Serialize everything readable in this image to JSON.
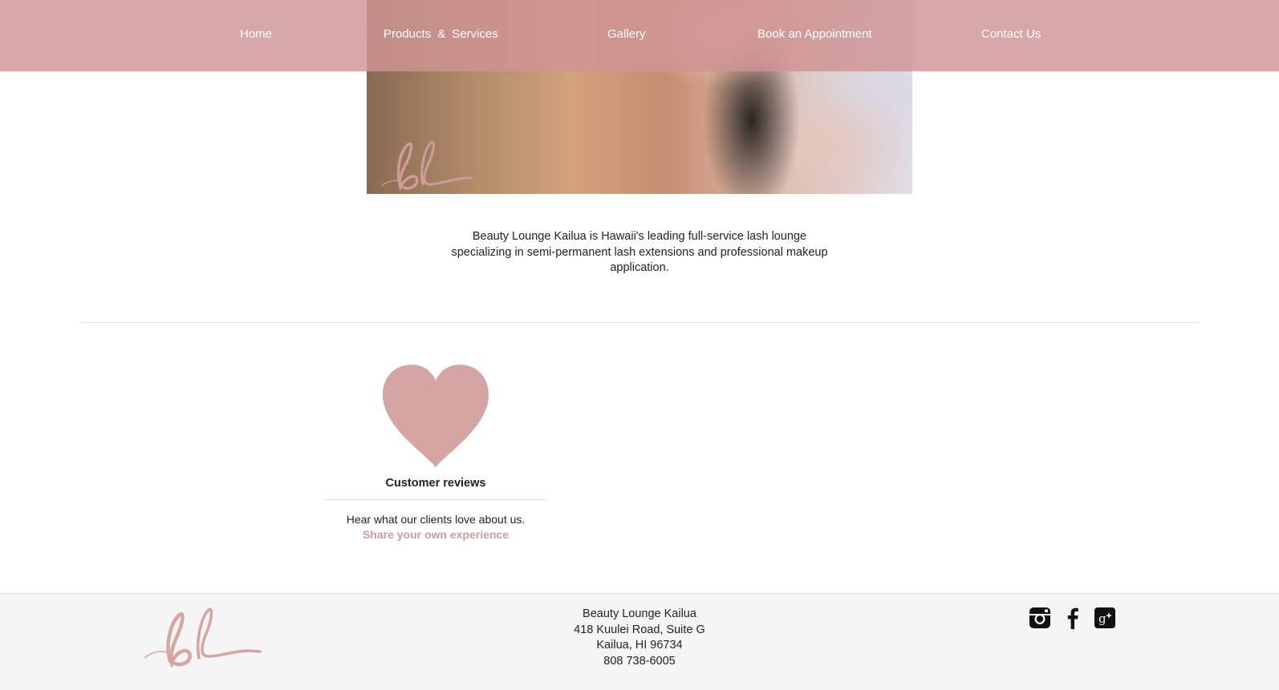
{
  "nav": {
    "home": "Home",
    "products": "Products",
    "amp": "&",
    "services": "Services",
    "gallery": "Gallery",
    "book": "Book an Appointment",
    "contact": "Contact Us"
  },
  "intro": {
    "text": "Beauty Lounge Kailua is Hawaii's leading full-service lash lounge specializing in semi-permanent lash extensions and professional makeup application."
  },
  "reviews": {
    "icon": "heart-icon",
    "title": "Customer reviews",
    "text": "Hear what our clients love about us.",
    "link": "Share your own experience"
  },
  "footer": {
    "name": "Beauty Lounge Kailua",
    "address_line1": "418 Kuulei Road, Suite G",
    "address_line2": "Kailua, HI 96734",
    "phone": "808 738-6005",
    "social_icons": [
      "instagram-icon",
      "facebook-icon",
      "google-plus-icon"
    ]
  },
  "colors": {
    "brand_pink": "#ce9494",
    "link_pink": "#d19b9b",
    "heart_pink": "#d4a5a3",
    "footer_bg": "#f5f5f5"
  }
}
